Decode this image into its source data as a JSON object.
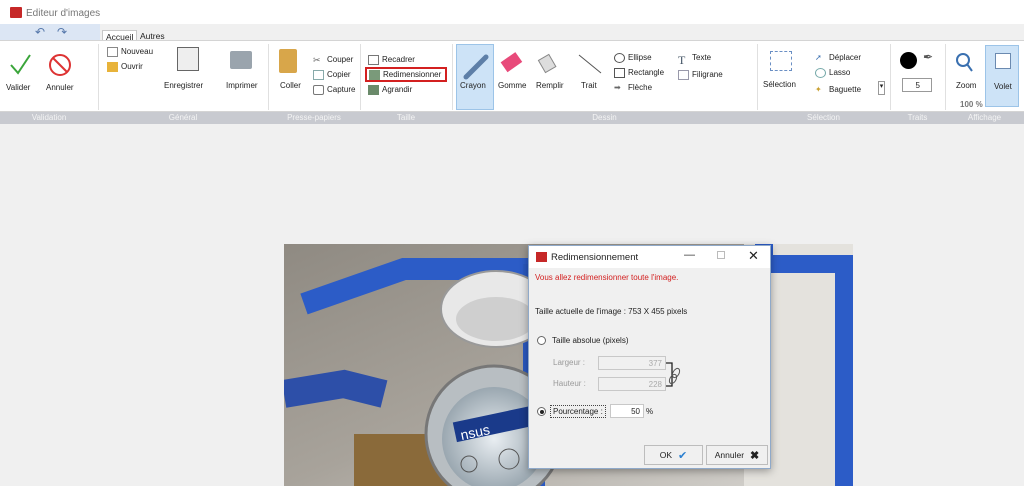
{
  "app": {
    "title": "Editeur d'images"
  },
  "tabs": [
    "Accueil",
    "Autres outils"
  ],
  "groups": {
    "validation": {
      "label": "Validation",
      "valider": "Valider",
      "annuler": "Annuler"
    },
    "general": {
      "label": "Général",
      "nouveau": "Nouveau",
      "ouvrir": "Ouvrir",
      "enregistrer": "Enregistrer",
      "imprimer": "Imprimer"
    },
    "presse": {
      "label": "Presse-papiers",
      "coller": "Coller",
      "couper": "Couper",
      "copier": "Copier",
      "capture": "Capture"
    },
    "taille": {
      "label": "Taille",
      "recadrer": "Recadrer",
      "redimensionner": "Redimensionner",
      "agrandir": "Agrandir"
    },
    "dessin": {
      "label": "Dessin",
      "crayon": "Crayon",
      "gomme": "Gomme",
      "remplir": "Remplir",
      "trait": "Trait",
      "ellipse": "Ellipse",
      "rectangle": "Rectangle",
      "fleche": "Flèche",
      "texte": "Texte",
      "filigrane": "Filigrane"
    },
    "selection": {
      "label": "Sélection",
      "selection": "Sélection",
      "deplacer": "Déplacer",
      "lasso": "Lasso",
      "baguette": "Baguette"
    },
    "traits": {
      "label": "Traits",
      "size": "5"
    },
    "affichage": {
      "label": "Affichage",
      "zoom": "Zoom",
      "volet": "Volet",
      "zoom_level": "100 %"
    }
  },
  "dialog": {
    "title": "Redimensionnement",
    "warning": "Vous allez redimensionner toute l'image.",
    "current_size": "Taille actuelle de l'image : 753 X 455 pixels",
    "absolute_label": "Taille absolue (pixels)",
    "largeur_label": "Largeur :",
    "largeur_value": "377",
    "hauteur_label": "Hauteur :",
    "hauteur_value": "228",
    "percent_label": "Pourcentage :",
    "percent_value": "50",
    "percent_unit": "%",
    "ok": "OK",
    "annuler": "Annuler"
  },
  "photo_meter_text": "nsus"
}
